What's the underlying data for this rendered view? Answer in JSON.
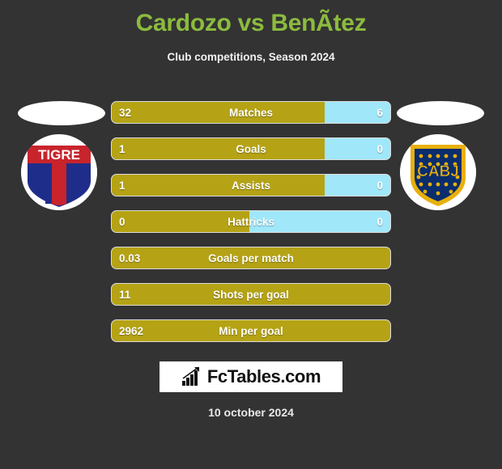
{
  "header": {
    "title": "Cardozo vs BenÃ­tez",
    "subtitle": "Club competitions, Season 2024",
    "title_color": "#8CBB3E",
    "background_color": "#333333"
  },
  "teams": {
    "home": {
      "crest_name": "tigre-crest",
      "crest_text": "TIGRE"
    },
    "away": {
      "crest_name": "boca-juniors-crest",
      "crest_text": "CABJ"
    }
  },
  "colors": {
    "home_bar": "#B5A315",
    "away_bar": "#A0E7FA",
    "bar_border": "#dcdcdc"
  },
  "stats": [
    {
      "label": "Matches",
      "home": "32",
      "away": "6",
      "split_pct": 76.5,
      "dual": true
    },
    {
      "label": "Goals",
      "home": "1",
      "away": "0",
      "split_pct": 76.5,
      "dual": true
    },
    {
      "label": "Assists",
      "home": "1",
      "away": "0",
      "split_pct": 76.5,
      "dual": true
    },
    {
      "label": "Hattricks",
      "home": "0",
      "away": "0",
      "split_pct": 49.5,
      "dual": true
    },
    {
      "label": "Goals per match",
      "home": "0.03",
      "away": "",
      "split_pct": 100,
      "dual": false
    },
    {
      "label": "Shots per goal",
      "home": "11",
      "away": "",
      "split_pct": 100,
      "dual": false
    },
    {
      "label": "Min per goal",
      "home": "2962",
      "away": "",
      "split_pct": 100,
      "dual": false
    }
  ],
  "watermark": {
    "text": "FcTables.com",
    "icon": "bar-chart-arrow-icon"
  },
  "footer": {
    "date": "10 october 2024"
  }
}
